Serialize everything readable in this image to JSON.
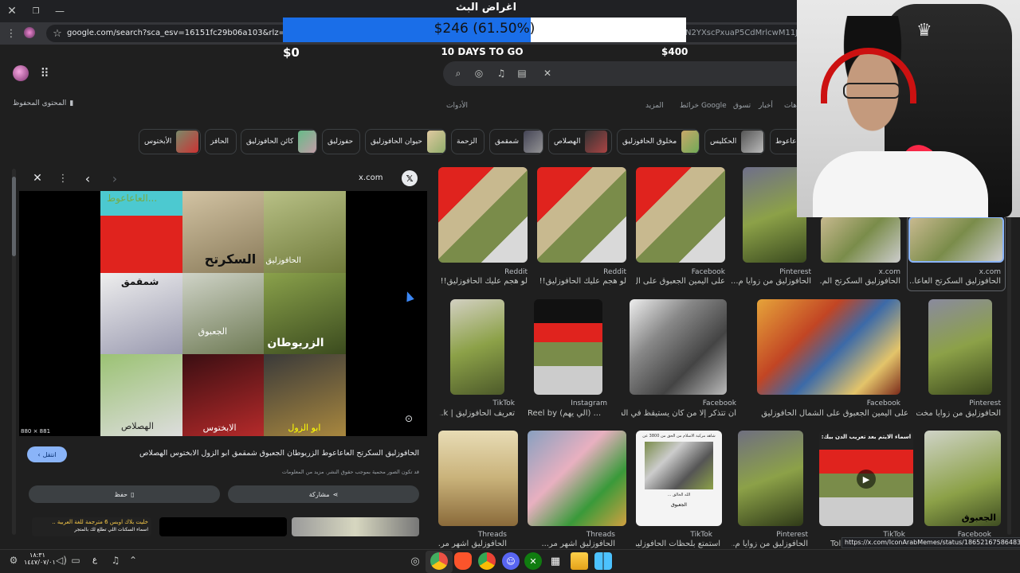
{
  "window": {
    "close_icon": "close-icon",
    "restore_icon": "restore-icon",
    "minimize_icon": "minimize-icon"
  },
  "address_bar": {
    "url": "google.com/search?sca_esv=16151fc29b06a103&rlz=1C1GCEA_e",
    "url_tail": "N2YXscPxuaP5CdMrlcwM11JNlaw"
  },
  "stream_goal": {
    "title": "اغراض البث",
    "amount": "$246 (61.50%)",
    "progress": 0.615,
    "min": "$0",
    "days_left": "10 DAYS TO GO",
    "max": "$400"
  },
  "search_toolbar": {
    "filters": [
      "الأدوات",
      "المزيد",
      "خرائط Google",
      "تسوق",
      "أخبار",
      "فيديوهات"
    ]
  },
  "saved_content": "المحتوى المحفوظ",
  "chips": [
    "الأبختوس",
    "الحافز",
    "كائن الحافوزليق",
    "حفوزليق",
    "حيوان الحافوزليق",
    "الزحمة",
    "شمقمق",
    "الهصلاص",
    "مخلوق الحافوزليق",
    "الحكليس",
    "العاعاعوط"
  ],
  "preview": {
    "source": "x.com",
    "image_size": "880 × 881",
    "grid_labels": [
      "العاعاعوط...",
      "السكرتح",
      "الحافوزليق",
      "شمقمق",
      "الجعبوق",
      "الزريوطان",
      "الهصلاص",
      "الابختوس",
      "ابو الزول"
    ],
    "visit_button": "انتقل",
    "title": "الحافوزليق السكرتح العاعاعوط الزريوطان الجعبوق شمقمق ابو الزول الابختوس الهصلاص",
    "copyright_note": "قد تكون الصور محمية بموجب حقوق النشر. مزيد من المعلومات",
    "save_button": "حفظ",
    "share_button": "مشاركة",
    "related_caption_1": "خليت بلاك اوبس 6 مترجمة للغة العربية ..",
    "related_caption_2": "اسماء السكنات اللي تطلع لك بالمتجر"
  },
  "results_row1": [
    {
      "source": "Reddit",
      "title": "لو هجم عليك الحافوزليق!! ..."
    },
    {
      "source": "Reddit",
      "title": "لو هجم عليك الحافوزليق!! ..."
    },
    {
      "source": "Facebook",
      "title": "على اليمين الجعبوق على ال..."
    },
    {
      "source": "Pinterest",
      "title": "الحافوزليق من زوايا م..."
    },
    {
      "source": "x.com",
      "title": "الحافوزليق السكرتح الم..."
    },
    {
      "source": "x.com",
      "title": "الحافوزليق السكرتح العاعا..."
    }
  ],
  "results_row2": [
    {
      "source": "TikTok",
      "title": "تعريف الحافوزليق | k..."
    },
    {
      "source": "Instagram",
      "title": "Reel by (الي يهم) ..."
    },
    {
      "source": "Facebook",
      "title": "أن تتذكر إلا من كان يستيقظ في السابع..."
    },
    {
      "source": "Facebook",
      "title": "على اليمين الجعبوق على الشمال الحافوزليق"
    },
    {
      "source": "Pinterest",
      "title": "الحافوزليق من زوايا مخت..."
    }
  ],
  "results_row3": [
    {
      "source": "Threads",
      "title": "الحافوزليق اشهر مر..."
    },
    {
      "source": "Threads",
      "title": "الحافوزليق اشهر مر..."
    },
    {
      "source": "TikTok",
      "title": "استمتع بلحظات الحافوزليق..."
    },
    {
      "source": "Pinterest",
      "title": "الحافوزليق من زوايا م..."
    },
    {
      "source": "TikTok",
      "title": "Tol"
    },
    {
      "source": "Facebook",
      "title": ""
    }
  ],
  "row3_overlay": {
    "card3_title": "شاهد مركبة الاسلام من الحق من 3800 عن",
    "card3_caption": "الله الخالق ...",
    "card3_bottom": "الجعبوق",
    "card5_title": "اسماء الايتم بعد تعريب الدن بيك:",
    "card6_label": "الجعبوق"
  },
  "status_url": "https://x.com/IconArabMemes/status/1865216758648369190",
  "taskbar": {
    "time": "١٨:٣١",
    "date": "١٤٤٧/٠٧/٠١",
    "lang": "ع"
  },
  "colors": {
    "goal_blue": "#1a6ee8",
    "accent_blue": "#8ab4f8",
    "page_bg": "#1f1f1f",
    "chrome_bg": "#202124"
  }
}
